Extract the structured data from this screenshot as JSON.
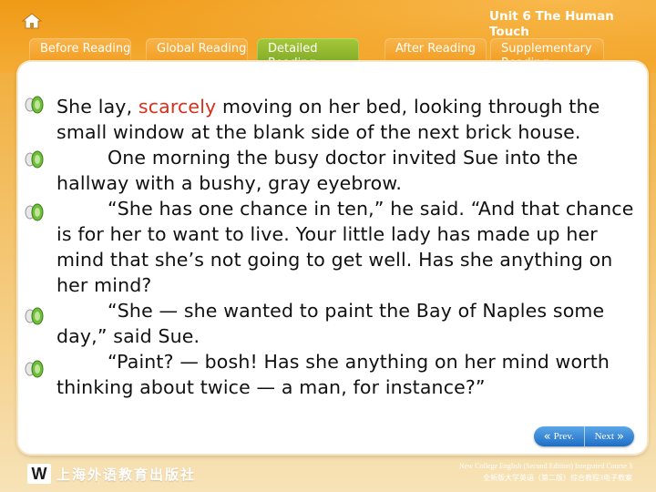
{
  "header": {
    "unit_title": "Unit 6 The Human Touch",
    "tabs": [
      {
        "label": "Before Reading",
        "active": false
      },
      {
        "label": "Global Reading",
        "active": false
      },
      {
        "label": "Detailed Reading",
        "active": true
      },
      {
        "label": "After Reading",
        "active": false
      },
      {
        "label": "Supplementary Reading",
        "active": false
      }
    ]
  },
  "content": {
    "para1_before": "She lay, ",
    "para1_highlight": "scarcely",
    "para1_after": " moving on her bed, looking through the small window at the blank side of the next brick house.",
    "para2": "One morning the busy doctor invited Sue into the hallway with a bushy, gray eyebrow.",
    "para3": "“She has one chance in ten,” he said. “And that chance is for her to want to live. Your little lady has made up her mind that she’s not going to get well. Has she anything on her mind?",
    "para4": "“She — she wanted to paint the Bay of Naples some day,” said Sue.",
    "para5": "“Paint? — bosh! Has she anything on her mind worth thinking about twice — a man, for instance?”",
    "highlight_color": "#d8301a"
  },
  "nav": {
    "prev_label": "Prev.",
    "next_label": "Next"
  },
  "footer": {
    "publisher": "上海外语教育出版社",
    "line1": "New College English (Second Edition) Integrated Course 3",
    "line2": "全新版大学英语（第二版）综合教程3电子教案"
  },
  "icons": {
    "home": "home-icon",
    "speaker": "speaker-icon"
  }
}
